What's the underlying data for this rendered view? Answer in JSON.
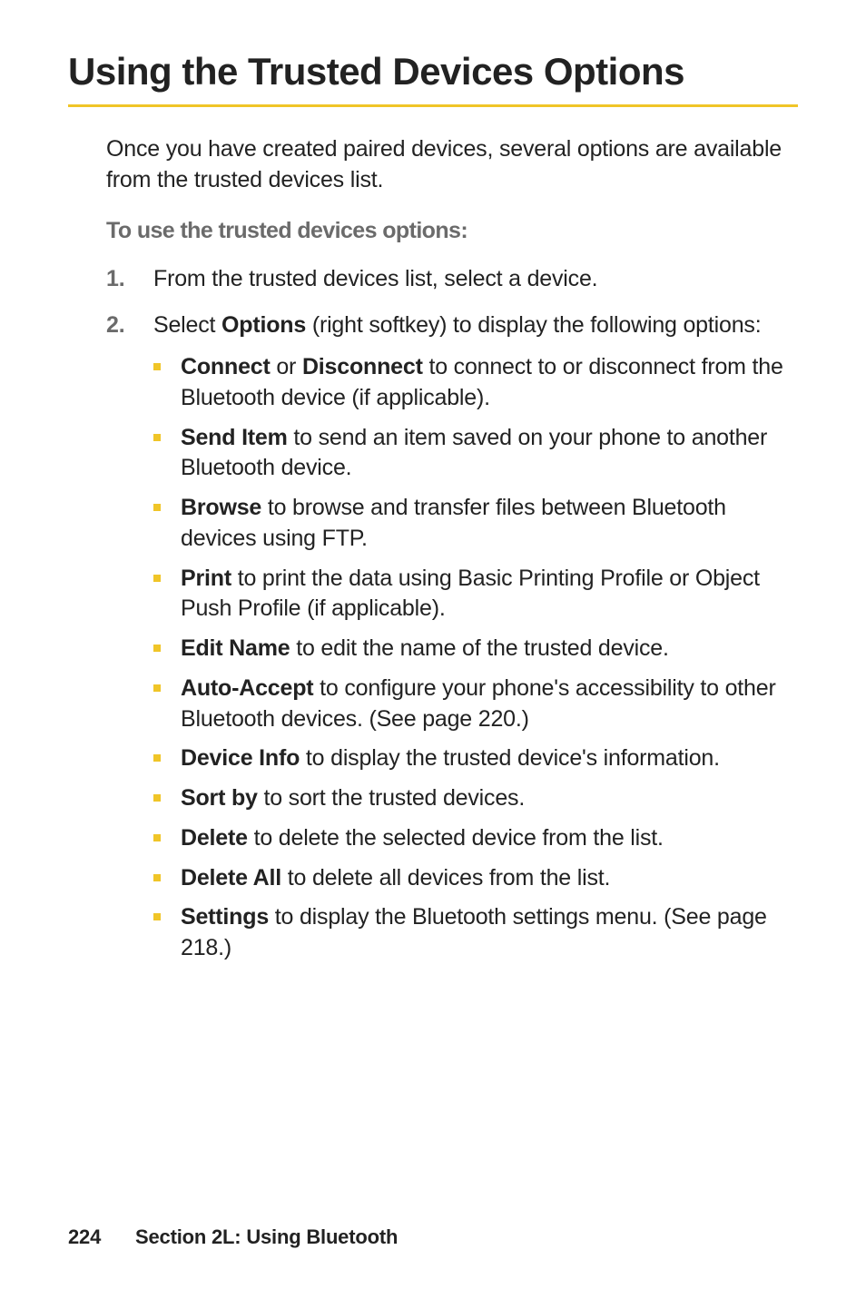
{
  "heading": "Using the Trusted Devices Options",
  "intro": "Once you have created paired devices, several options are available from the trusted devices list.",
  "subheading": "To use the trusted devices options:",
  "steps": [
    {
      "marker": "1.",
      "text": "From the trusted devices list, select a device."
    },
    {
      "marker": "2.",
      "prefix": "Select ",
      "bold1": "Options",
      "suffix": " (right softkey) to display the following options:"
    }
  ],
  "options": [
    {
      "bold": "Connect",
      "mid": " or ",
      "bold2": "Disconnect",
      "rest": " to connect to or disconnect from the Bluetooth device (if applicable)."
    },
    {
      "bold": "Send Item",
      "rest": " to send an item saved on your phone to another Bluetooth device."
    },
    {
      "bold": "Browse",
      "rest": " to browse and transfer files between Bluetooth devices using FTP."
    },
    {
      "bold": "Print",
      "rest": " to print the data using Basic Printing Profile or Object Push Profile (if applicable)."
    },
    {
      "bold": "Edit Name",
      "rest": " to edit the name of the trusted device."
    },
    {
      "bold": "Auto-Accept",
      "rest": " to configure your phone's accessibility to other Bluetooth devices. (See page 220.)"
    },
    {
      "bold": "Device Info",
      "rest": " to display the trusted device's information."
    },
    {
      "bold": "Sort by",
      "rest": " to sort the trusted devices."
    },
    {
      "bold": "Delete",
      "rest": " to delete the selected device from the list."
    },
    {
      "bold": "Delete All",
      "rest": " to delete all devices from the list."
    },
    {
      "bold": "Settings",
      "rest": " to display the Bluetooth settings menu. (See page 218.)"
    }
  ],
  "footer": {
    "page": "224",
    "section": "Section 2L: Using Bluetooth"
  }
}
